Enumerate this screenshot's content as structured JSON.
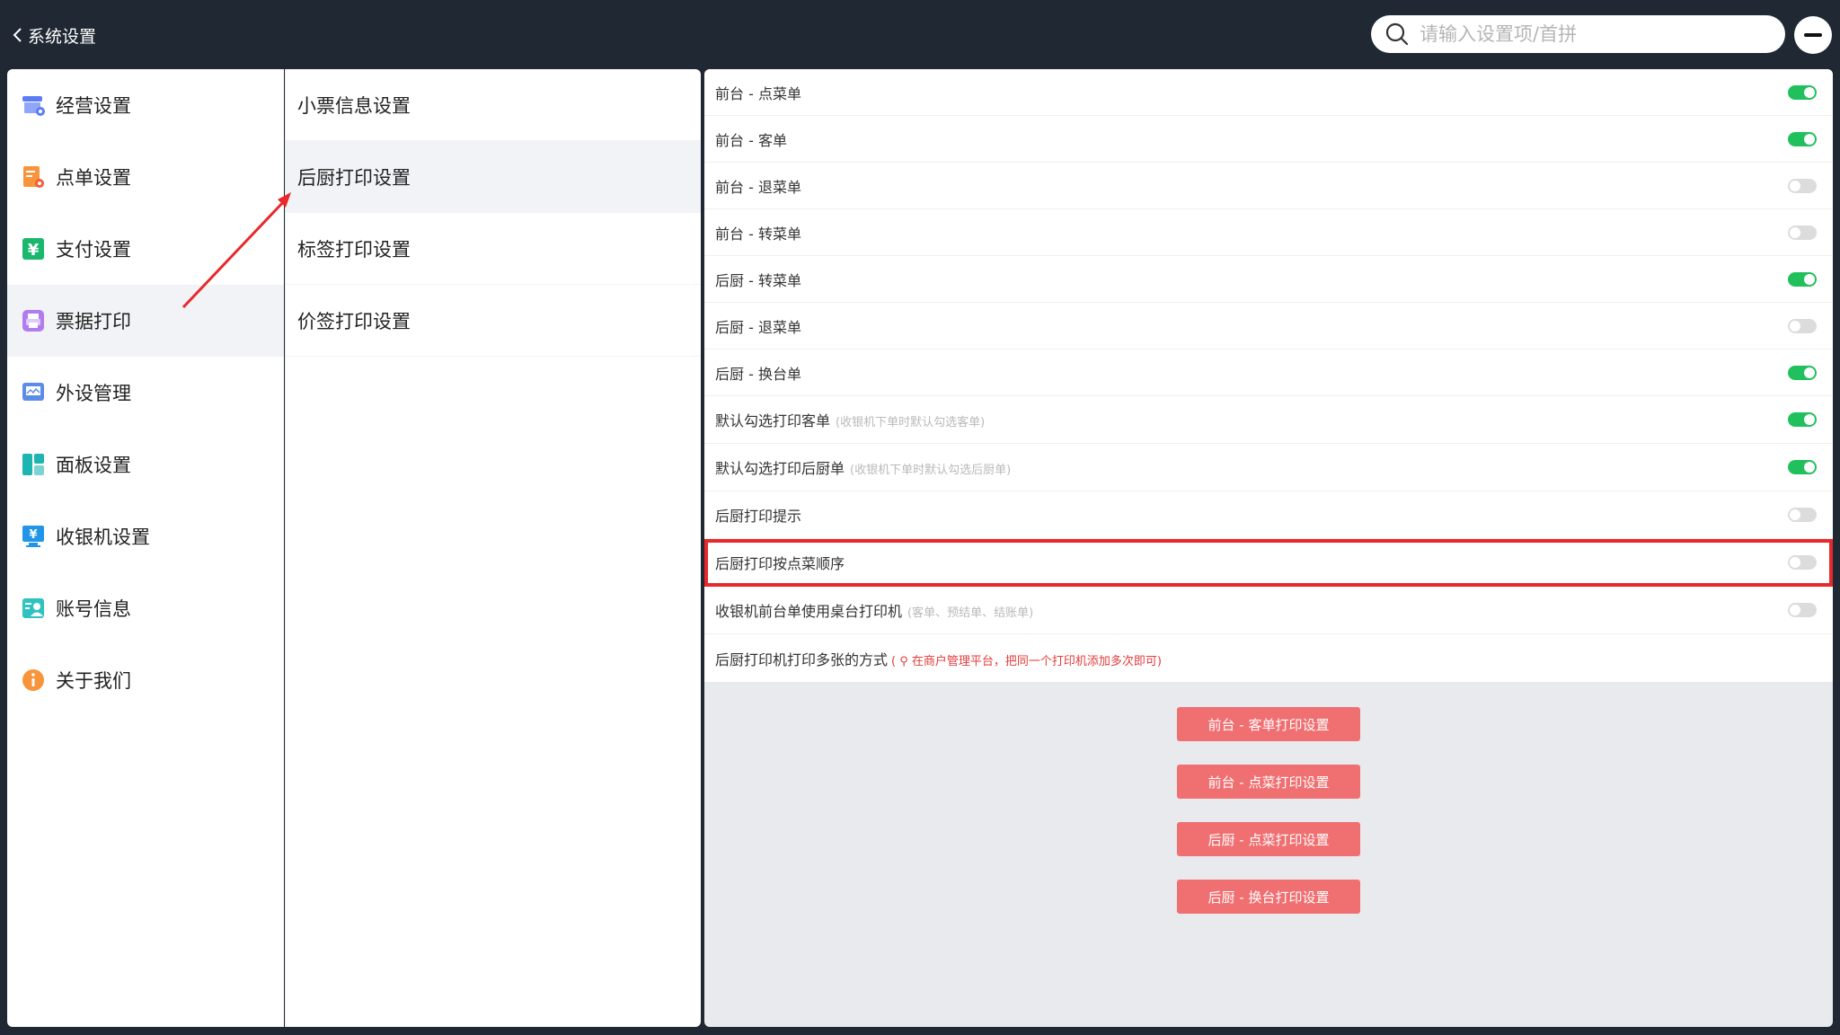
{
  "header": {
    "back_label": "系统设置",
    "search_placeholder": "请输入设置项/首拼"
  },
  "sidebar": {
    "items": [
      {
        "label": "经营设置",
        "icon": "store-settings-icon"
      },
      {
        "label": "点单设置",
        "icon": "order-icon"
      },
      {
        "label": "支付设置",
        "icon": "payment-yen-icon"
      },
      {
        "label": "票据打印",
        "icon": "printer-icon"
      },
      {
        "label": "外设管理",
        "icon": "peripheral-monitor-icon"
      },
      {
        "label": "面板设置",
        "icon": "panel-layout-icon"
      },
      {
        "label": "收银机设置",
        "icon": "cash-register-icon"
      },
      {
        "label": "账号信息",
        "icon": "account-card-icon"
      },
      {
        "label": "关于我们",
        "icon": "info-icon"
      }
    ],
    "active_index": 3
  },
  "submenu": {
    "items": [
      {
        "label": "小票信息设置"
      },
      {
        "label": "后厨打印设置"
      },
      {
        "label": "标签打印设置"
      },
      {
        "label": "价签打印设置"
      }
    ],
    "active_index": 1
  },
  "settings": {
    "rows": [
      {
        "label": "前台 - 点菜单",
        "on": true
      },
      {
        "label": "前台 - 客单",
        "on": true
      },
      {
        "label": "前台 - 退菜单",
        "on": false
      },
      {
        "label": "前台 - 转菜单",
        "on": false
      },
      {
        "label": "后厨 - 转菜单",
        "on": true
      },
      {
        "label": "后厨 - 退菜单",
        "on": false
      },
      {
        "label": "后厨 - 换台单",
        "on": true
      },
      {
        "label": "默认勾选打印客单",
        "note": "(收银机下单时默认勾选客单)",
        "on": true
      },
      {
        "label": "默认勾选打印后厨单",
        "note": "(收银机下单时默认勾选后厨单)",
        "on": true
      },
      {
        "label": "后厨打印提示",
        "on": false
      },
      {
        "label": "后厨打印按点菜顺序",
        "on": false,
        "highlighted": true
      },
      {
        "label": "收银机前台单使用桌台打印机",
        "note": "(客单、预结单、结账单)",
        "on": false
      }
    ],
    "multi_copy_label": "后厨打印机打印多张的方式",
    "multi_copy_note": "( ⚲ 在商户管理平台，把同一个打印机添加多次即可)"
  },
  "buttons": [
    {
      "label": "前台 - 客单打印设置"
    },
    {
      "label": "前台 - 点菜打印设置"
    },
    {
      "label": "后厨 - 点菜打印设置"
    },
    {
      "label": "后厨 - 换台打印设置"
    }
  ],
  "colors": {
    "toggle_on": "#20c05c",
    "toggle_off": "#dcdcdc",
    "button": "#f07072",
    "highlight": "#e8282b",
    "topbar": "#1f2833"
  }
}
